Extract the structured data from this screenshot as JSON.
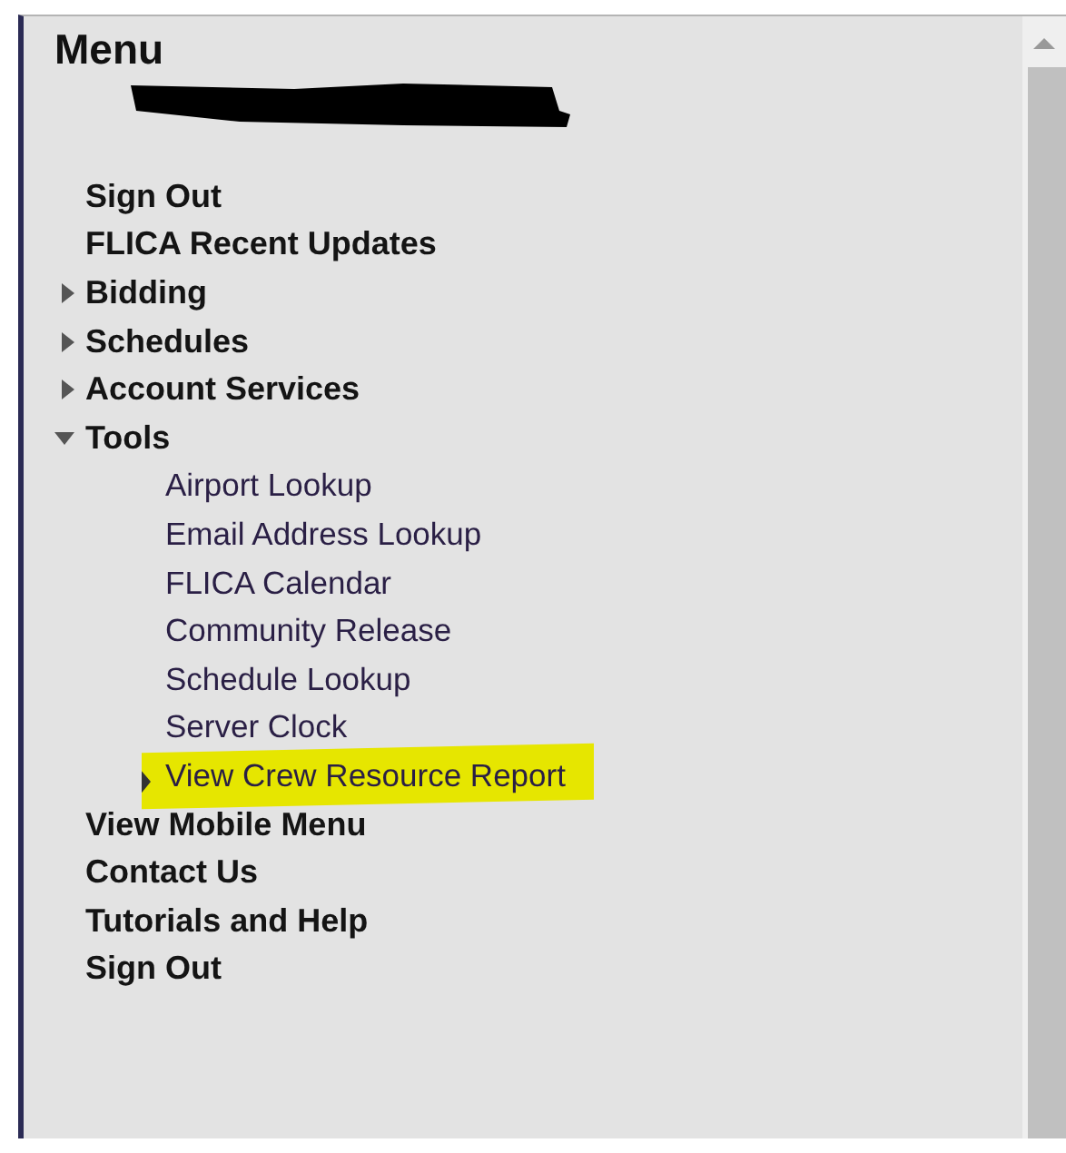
{
  "title": "Menu",
  "items": [
    {
      "kind": "link",
      "label": "Sign Out"
    },
    {
      "kind": "link",
      "label": "FLICA Recent Updates"
    },
    {
      "kind": "folder",
      "label": "Bidding",
      "expanded": false
    },
    {
      "kind": "folder",
      "label": "Schedules",
      "expanded": false
    },
    {
      "kind": "folder",
      "label": "Account Services",
      "expanded": false
    },
    {
      "kind": "folder",
      "label": "Tools",
      "expanded": true,
      "children": [
        {
          "label": "Airport Lookup",
          "selected": false
        },
        {
          "label": "Email Address Lookup",
          "selected": false
        },
        {
          "label": "FLICA Calendar",
          "selected": false
        },
        {
          "label": "Community Release",
          "selected": false
        },
        {
          "label": "Schedule Lookup",
          "selected": false
        },
        {
          "label": "Server Clock",
          "selected": false
        },
        {
          "label": "View Crew Resource Report",
          "selected": true
        }
      ]
    },
    {
      "kind": "link",
      "label": "View Mobile Menu"
    },
    {
      "kind": "link",
      "label": "Contact Us"
    },
    {
      "kind": "link",
      "label": "Tutorials and Help"
    },
    {
      "kind": "link",
      "label": "Sign Out"
    }
  ]
}
